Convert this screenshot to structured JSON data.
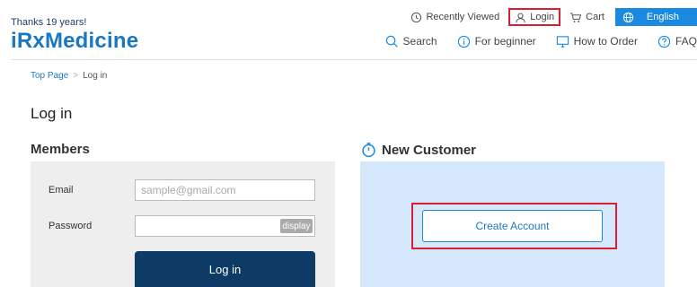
{
  "header": {
    "tagline": "Thanks 19 years!",
    "logo_text": "iRxMedicine",
    "top_links": {
      "recently_viewed": "Recently Viewed",
      "login": "Login",
      "cart": "Cart",
      "language": "English"
    },
    "main_nav": {
      "search": "Search",
      "for_beginner": "For beginner",
      "how_to_order": "How to Order",
      "faq": "FAQ"
    }
  },
  "breadcrumb": {
    "home": "Top Page",
    "separator": ">",
    "current": "Log in"
  },
  "page_title": "Log in",
  "members": {
    "title": "Members",
    "email_label": "Email",
    "email_placeholder": "sample@gmail.com",
    "password_label": "Password",
    "display_label": "display",
    "login_button": "Log in"
  },
  "new_customer": {
    "title": "New Customer",
    "create_button": "Create Account"
  },
  "colors": {
    "brand_blue": "#1a78c2",
    "navy": "#0e3a66",
    "highlight_red": "#d81e35",
    "panel_blue": "#d5e8fb",
    "panel_gray": "#eeeeee"
  }
}
